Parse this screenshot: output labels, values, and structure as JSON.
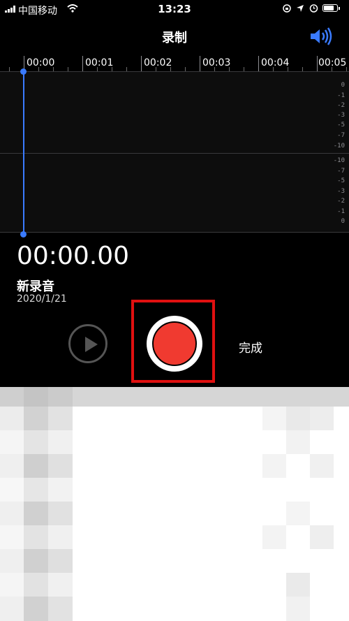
{
  "status": {
    "carrier": "中国移动",
    "time": "13:23"
  },
  "header": {
    "title": "录制",
    "speaker_icon": "speaker-volume-icon"
  },
  "ruler": {
    "labels": [
      "00:00",
      "00:01",
      "00:02",
      "00:03",
      "00:04",
      "00:05"
    ]
  },
  "waveform": {
    "db_top": [
      "0",
      "-1",
      "-2",
      "-3",
      "-5",
      "-7",
      "-10"
    ],
    "db_bottom": [
      "-10",
      "-7",
      "-5",
      "-3",
      "-2",
      "-1",
      "0"
    ]
  },
  "recording": {
    "elapsed": "00:00.00",
    "name": "新录音",
    "date": "2020/1/21"
  },
  "controls": {
    "done_label": "完成"
  },
  "colors": {
    "accent": "#3a7bff",
    "record": "#f03a30",
    "highlight": "#e01010"
  }
}
